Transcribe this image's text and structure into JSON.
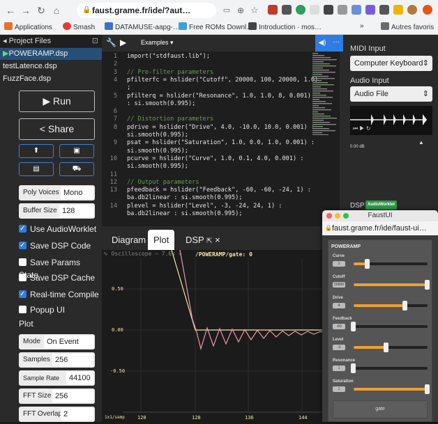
{
  "browser": {
    "url": "faust.grame.fr/ide/?aut…",
    "bookmarks": [
      "Applications",
      "Smash",
      "DATAMUSE-aapg-…",
      "Free ROMs Downl…",
      "Introduction · mos…",
      "»",
      "Autres favoris"
    ]
  },
  "sidebar": {
    "title": "Project Files",
    "files": [
      "POWERAMP.dsp",
      "testLatence.dsp",
      "FuzzFace.dsp"
    ],
    "run_label": "Run",
    "share_label": "Share",
    "poly_voices_label": "Poly Voices",
    "poly_voices_value": "Mono",
    "buffer_size_label": "Buffer Size",
    "buffer_size_value": "128",
    "checkboxes": [
      {
        "label": "Use AudioWorklet",
        "checked": true
      },
      {
        "label": "Save DSP Code",
        "checked": true
      },
      {
        "label": "Save Params State",
        "checked": false
      },
      {
        "label": "Save DSP Cache",
        "checked": false
      },
      {
        "label": "Real-time Compile",
        "checked": true
      },
      {
        "label": "Popup UI",
        "checked": false
      }
    ],
    "plot_heading": "Plot",
    "mode_label": "Mode",
    "mode_value": "On Event",
    "samples_label": "Samples",
    "samples_value": "256",
    "sample_rate_label": "Sample Rate",
    "sample_rate_value": "44100",
    "fft_size_label": "FFT Size",
    "fft_size_value": "256",
    "fft_overlap_label": "FFT Overlap",
    "fft_overlap_value": "2"
  },
  "editor": {
    "examples_label": "Examples ▾",
    "lines": [
      {
        "n": "1",
        "text": "import(\"stdfaust.lib\");"
      },
      {
        "n": "2",
        "text": ""
      },
      {
        "n": "3",
        "text": "// Pre-filter parameters"
      },
      {
        "n": "4",
        "text": "pfilterfc = hslider(\"Cutoff\", 20000, 100, 20000, 1.0)"
      },
      {
        "n": "",
        "text": ";"
      },
      {
        "n": "5",
        "text": "pfilterq = hslider(\"Resonance\", 1.0, 1.0, 8, 0.001)"
      },
      {
        "n": "",
        "text": ": si.smooth(0.995);"
      },
      {
        "n": "6",
        "text": ""
      },
      {
        "n": "7",
        "text": "// Distortion parameters"
      },
      {
        "n": "8",
        "text": "pdrive = hslider(\"Drive\", 4.0, -10.0, 10.0, 0.001) :"
      },
      {
        "n": "",
        "text": "si.smooth(0.995);"
      },
      {
        "n": "9",
        "text": "psat = hslider(\"Saturation\", 1.0, 0.0, 1.0, 0.001) :"
      },
      {
        "n": "",
        "text": "si.smooth(0.995);"
      },
      {
        "n": "10",
        "text": "pcurve = hslider(\"Curve\", 1.0, 0.1, 4.0, 0.001) :"
      },
      {
        "n": "",
        "text": "si.smooth(0.995);"
      },
      {
        "n": "11",
        "text": ""
      },
      {
        "n": "12",
        "text": "// Output parameters"
      },
      {
        "n": "13",
        "text": "pfeedback = hslider(\"Feedback\", -60, -60, -24, 1) :"
      },
      {
        "n": "",
        "text": "ba.db2linear : si.smooth(0.995);"
      },
      {
        "n": "14",
        "text": "plevel = hslider(\"Level\", -3, -24, 24, 1) :"
      },
      {
        "n": "",
        "text": "ba.db2linear : si.smooth(0.995);"
      }
    ]
  },
  "right": {
    "midi_input_label": "MIDI Input",
    "midi_input_value": "Computer Keyboard",
    "audio_input_label": "Audio Input",
    "audio_input_value": "Audio File",
    "level_readout": "0.00 dB",
    "dsp_label": "DSP",
    "dsp_badge": "AudioWorklet"
  },
  "bottom": {
    "tabs": [
      "Diagram",
      "Plot",
      "DSP"
    ],
    "active_tab": "Plot",
    "dsp_tab_extra": "×",
    "scope_title": "Oscilloscope",
    "scope_zoom": "7.6x",
    "scope_add": "+",
    "scope_path": "/POWERAMP/gate: 0",
    "y_ticks": [
      "0.50",
      "0.00",
      "-0.50"
    ],
    "x_ticks": [
      "120",
      "128",
      "136",
      "144"
    ],
    "x_unit": "1x1/samp"
  },
  "faust_ui": {
    "window_title": "FaustUI",
    "url": "faust.grame.fr/ide/faust-ui…",
    "group_title": "POWERAMP",
    "sliders": [
      {
        "label": "Curve",
        "value": "1",
        "fraction": 0.19
      },
      {
        "label": "Cutoff",
        "value": "20000",
        "fraction": 1.0
      },
      {
        "label": "Drive",
        "value": "4",
        "fraction": 0.7
      },
      {
        "label": "Feedback",
        "value": "-60",
        "fraction": 0.0
      },
      {
        "label": "Level",
        "value": "-3",
        "fraction": 0.44
      },
      {
        "label": "Resonance",
        "value": "1",
        "fraction": 0.0
      },
      {
        "label": "Saturation",
        "value": "1",
        "fraction": 1.0
      }
    ],
    "gate_label": "gate"
  },
  "colors": {
    "accent": "#2f7de1",
    "slider_fill": "#f0a030",
    "scope_line1": "#f5e6a6",
    "scope_line2": "#e89aa4"
  }
}
